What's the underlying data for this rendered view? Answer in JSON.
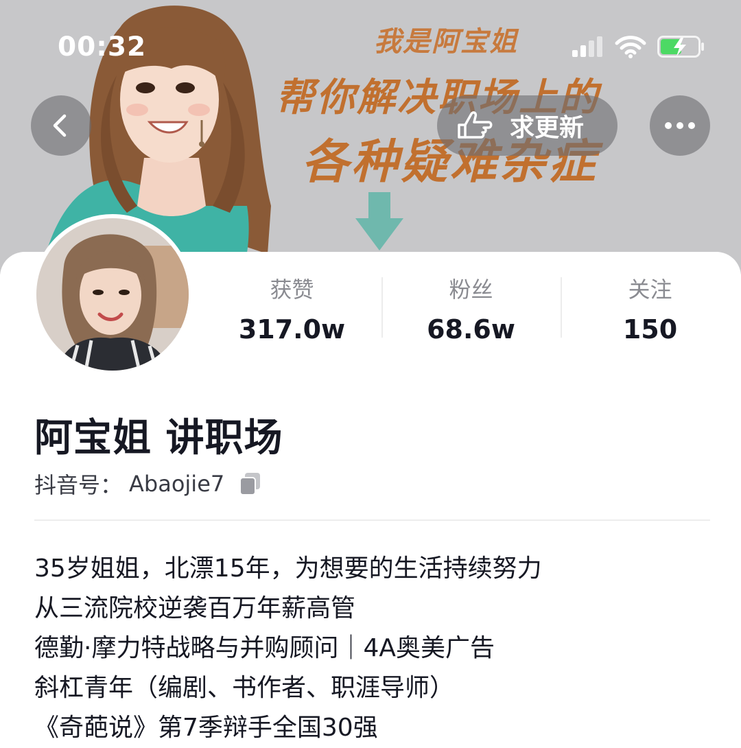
{
  "status_bar": {
    "time": "00:32"
  },
  "banner": {
    "line1": "我是阿宝姐",
    "line2": "帮你解决职场上的",
    "line3": "各种疑难杂症"
  },
  "header": {
    "back_icon": "chevron-left-icon",
    "update_label": "求更新",
    "update_icon": "pointing-hand-icon",
    "more_icon": "ellipsis-icon"
  },
  "profile": {
    "stats": [
      {
        "label": "获赞",
        "value": "317.0w"
      },
      {
        "label": "粉丝",
        "value": "68.6w"
      },
      {
        "label": "关注",
        "value": "150"
      }
    ],
    "name": "阿宝姐 讲职场",
    "account_label": "抖音号：",
    "account_id": "Abaojie7",
    "bio": [
      "35岁姐姐，北漂15年，为想要的生活持续努力",
      "从三流院校逆袭百万年薪高管",
      "德勤·摩力特战略与并购顾问｜4A奥美广告",
      "斜杠青年（编剧、书作者、职涯导师）",
      "《奇葩说》第7季辩手全国30强"
    ]
  },
  "colors": {
    "banner_bg": "#c7c7c9",
    "banner_text": "#c1702f",
    "button_bg": "#6e6e73",
    "battery_green": "#4cd964",
    "stat_label": "#8a8b91",
    "text_primary": "#161823"
  }
}
